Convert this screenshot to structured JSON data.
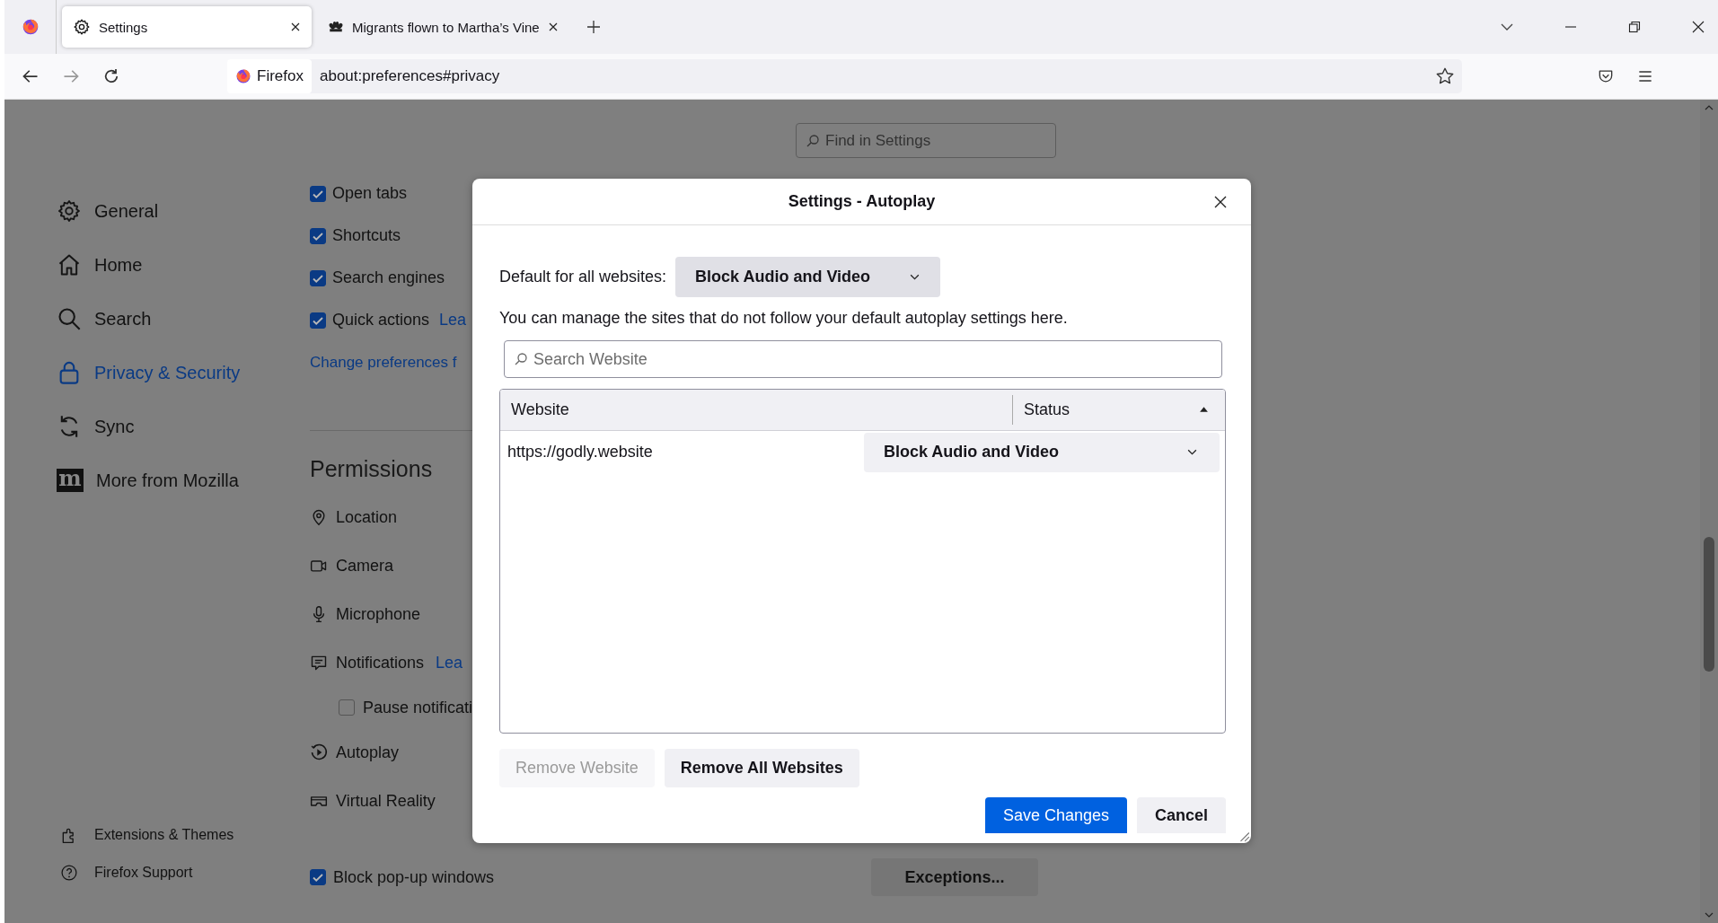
{
  "browser_tabs": [
    {
      "title": "Settings",
      "selected": true
    },
    {
      "title": "Migrants flown to Martha’s Vine",
      "selected": false
    }
  ],
  "address_bar": {
    "identity": "Firefox",
    "url": "about:preferences#privacy"
  },
  "find_field": {
    "placeholder": "Find in Settings"
  },
  "sidebar": {
    "items": [
      {
        "label": "General",
        "selected": false
      },
      {
        "label": "Home",
        "selected": false
      },
      {
        "label": "Search",
        "selected": false
      },
      {
        "label": "Privacy & Security",
        "selected": true
      },
      {
        "label": "Sync",
        "selected": false
      },
      {
        "label": "More from Mozilla",
        "logo_text": "m",
        "selected": false
      }
    ],
    "footer": [
      {
        "label": "Extensions & Themes"
      },
      {
        "label": "Firefox Support"
      }
    ]
  },
  "options": [
    {
      "kind": "checkbox",
      "label": "Open tabs",
      "checked": true
    },
    {
      "kind": "checkbox",
      "label": "Shortcuts",
      "checked": true
    },
    {
      "kind": "checkbox",
      "label": "Search engines",
      "checked": true
    },
    {
      "kind": "checkbox",
      "label": "Quick actions",
      "checked": true,
      "link": "Lea"
    },
    {
      "kind": "link",
      "label": "Change preferences f"
    }
  ],
  "permissions": {
    "title": "Permissions",
    "items": [
      {
        "kind": "permission",
        "label": "Location"
      },
      {
        "kind": "permission",
        "label": "Camera"
      },
      {
        "kind": "permission",
        "label": "Microphone"
      },
      {
        "kind": "permission",
        "label": "Notifications",
        "link": "Lea"
      },
      {
        "kind": "checkbox",
        "label": "Pause notificati",
        "checked": false
      },
      {
        "kind": "permission",
        "label": "Autoplay"
      },
      {
        "kind": "permission",
        "label": "Virtual Reality"
      }
    ]
  },
  "popups": {
    "label": "Block pop-up windows",
    "checked": true,
    "button": "Exceptions..."
  },
  "dialog": {
    "title": "Settings - Autoplay",
    "default_label": "Default for all websites:",
    "default_value": "Block Audio and Video",
    "description": "You can manage the sites that do not follow your default autoplay settings here.",
    "search": {
      "placeholder": "Search Website"
    },
    "columns": [
      {
        "label": "Website",
        "sorted": false
      },
      {
        "label": "Status",
        "sorted": true
      }
    ],
    "rows": [
      {
        "website": "https://godly.website",
        "status": "Block Audio and Video"
      }
    ],
    "buttons": [
      {
        "label": "Remove Website",
        "disabled": true
      },
      {
        "label": "Remove All Websites",
        "disabled": false
      }
    ],
    "footer_buttons": [
      {
        "label": "Save Changes",
        "primary": true
      },
      {
        "label": "Cancel",
        "primary": false
      }
    ]
  }
}
